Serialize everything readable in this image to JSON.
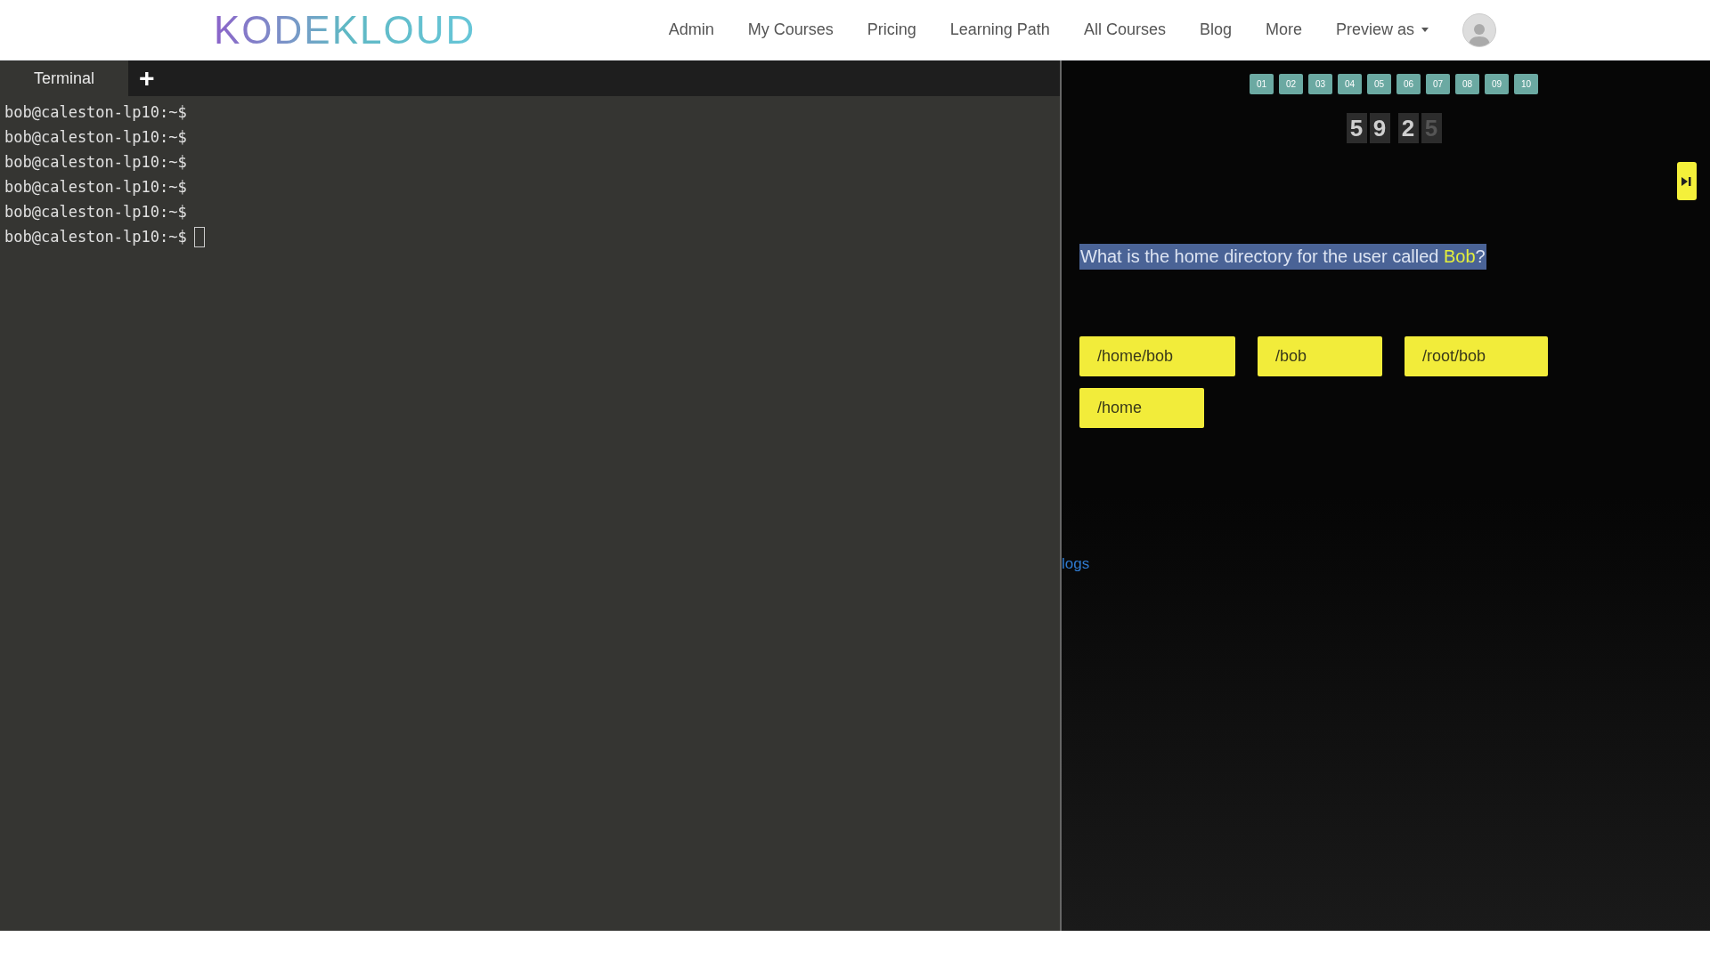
{
  "header": {
    "logo": "KODEKLOUD",
    "nav": [
      "Admin",
      "My Courses",
      "Pricing",
      "Learning Path",
      "All Courses",
      "Blog",
      "More",
      "Preview as"
    ]
  },
  "terminal": {
    "tabs": [
      {
        "label": "Terminal",
        "selected": true
      }
    ],
    "add_tab": "+",
    "lines": [
      "bob@caleston-lp10:~$",
      "bob@caleston-lp10:~$",
      "bob@caleston-lp10:~$",
      "bob@caleston-lp10:~$",
      "bob@caleston-lp10:~$",
      "bob@caleston-lp10:~$"
    ]
  },
  "quiz": {
    "questions": [
      "01",
      "02",
      "03",
      "04",
      "05",
      "06",
      "07",
      "08",
      "09",
      "10"
    ],
    "timer": [
      {
        "digit": "5",
        "flipping": false
      },
      {
        "digit": "9",
        "flipping": false
      },
      {
        "digit": "2",
        "flipping": false
      },
      {
        "digit": "5",
        "flipping": true
      }
    ],
    "question": [
      {
        "text": "What is the home directory for the user called ",
        "highlight": false
      },
      {
        "text": "Bob",
        "highlight": true
      },
      {
        "text": "?",
        "highlight": false
      }
    ],
    "answers": [
      "/home/bob",
      "/bob",
      "/root/bob",
      "/home"
    ],
    "logs_link": "logs"
  }
}
